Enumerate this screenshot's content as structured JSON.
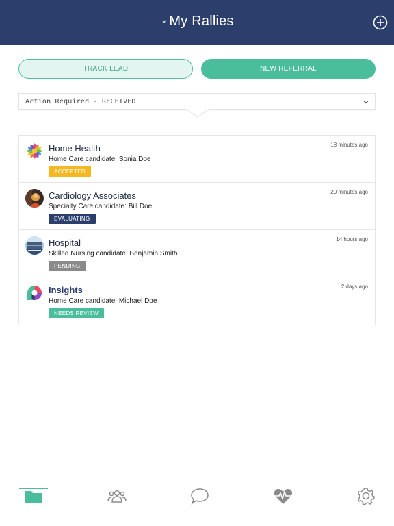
{
  "header": {
    "title": "My Rallies",
    "chevron": "chevron-down-icon",
    "add_icon": "plus-circle-icon"
  },
  "buttons": {
    "track": "TRACK LEAD",
    "referral": "NEW REFERRAL"
  },
  "filter": {
    "value": "Action Required - RECEIVED"
  },
  "rallies": [
    {
      "title": "Home Health",
      "subtitle": "Home Care candidate: Sonia Doe",
      "time": "18 minutes ago",
      "status": "ACCEPTED",
      "status_color": "#f5b821",
      "avatar": "flower-avatar"
    },
    {
      "title": "Cardiology Associates",
      "subtitle": "Specialty Care candidate: Bill Doe",
      "time": "20 minutes ago",
      "status": "EVALUATING",
      "status_color": "#2c3e6b",
      "avatar": "portrait-avatar"
    },
    {
      "title": "Hospital",
      "subtitle": "Skilled Nursing candidate: Benjamin Smith",
      "time": "14 hours ago",
      "status": "PENDING",
      "status_color": "#8a8a8a",
      "avatar": "building-avatar"
    },
    {
      "title": "Insights",
      "subtitle": "Home Care candidate: Michael Doe",
      "time": "2 days ago",
      "status": "NEEDS REVIEW",
      "status_color": "#4abd9c",
      "avatar": "insights-logo"
    }
  ],
  "tabs": [
    {
      "icon": "folder-icon",
      "active": true
    },
    {
      "icon": "people-icon",
      "active": false
    },
    {
      "icon": "chat-bubble-icon",
      "active": false
    },
    {
      "icon": "heartbeat-icon",
      "active": false
    },
    {
      "icon": "gear-icon",
      "active": false
    }
  ],
  "colors": {
    "navy": "#2c3e6b",
    "teal": "#4abd9c",
    "teal_light": "#e3f5f0"
  }
}
